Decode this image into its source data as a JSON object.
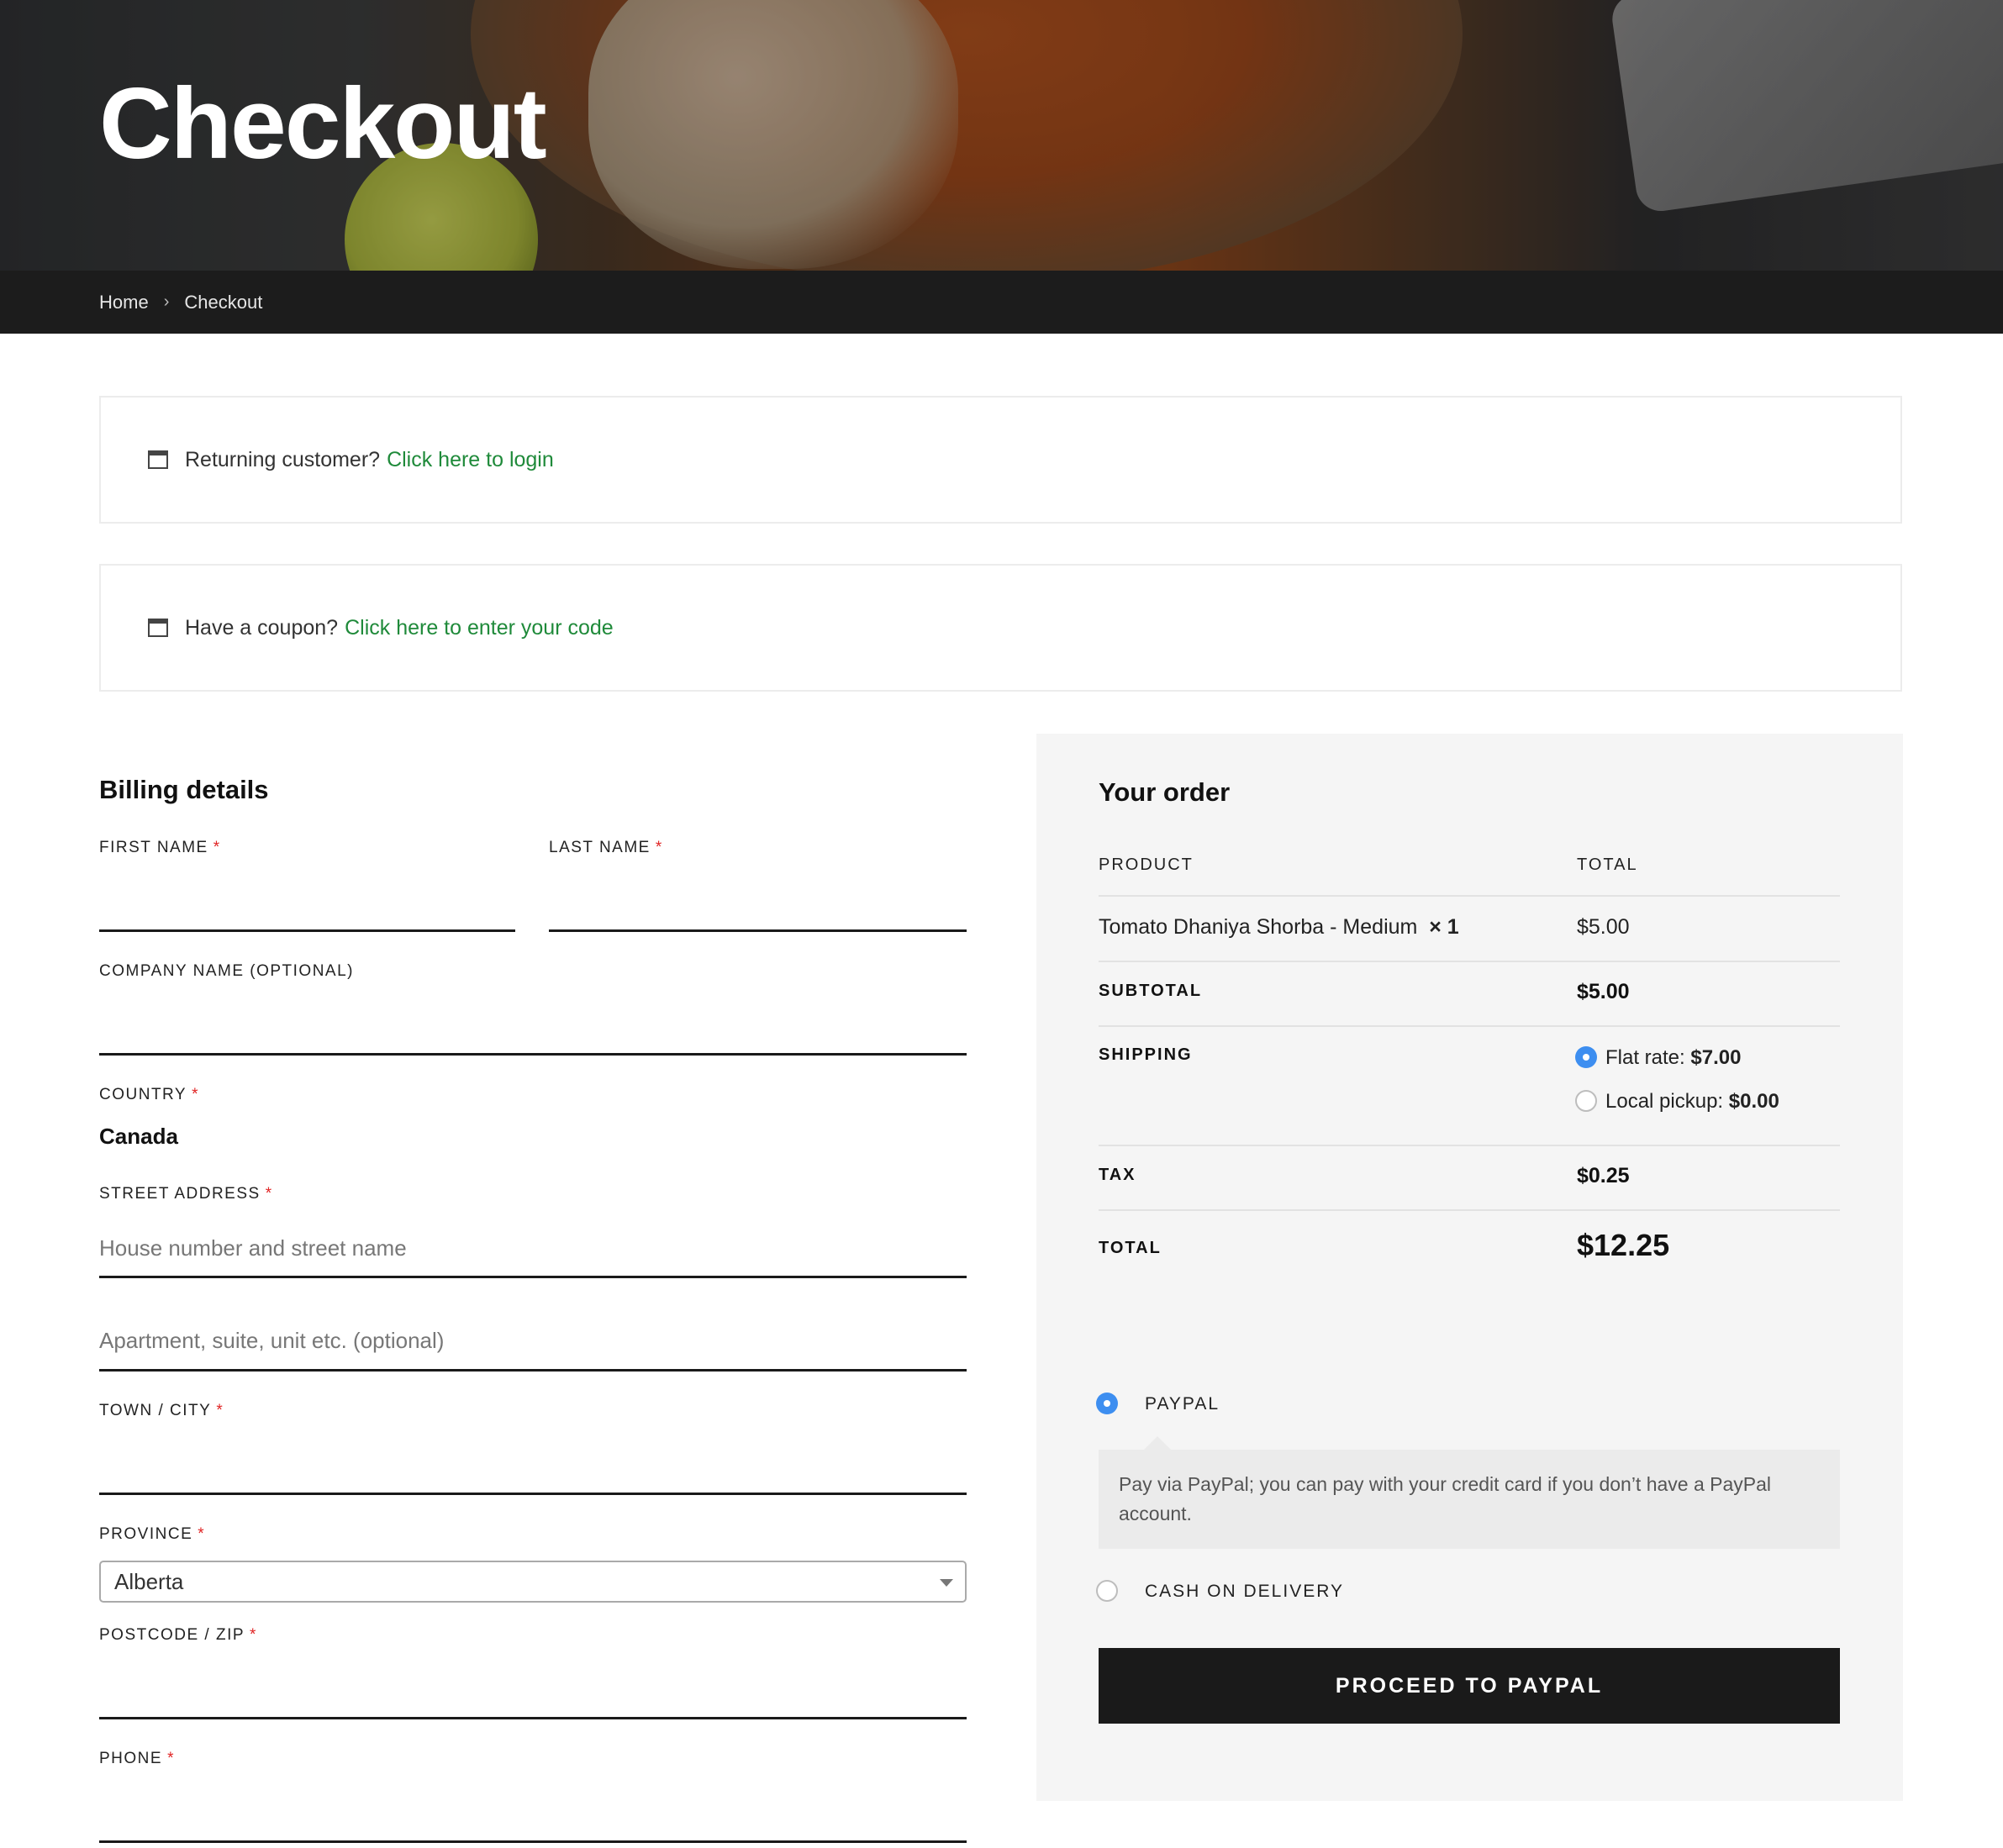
{
  "hero": {
    "title": "Checkout"
  },
  "breadcrumb": {
    "items": [
      "Home",
      "Checkout"
    ],
    "separator": "›"
  },
  "notices": [
    {
      "text": "Returning customer?",
      "link": "Click here to login"
    },
    {
      "text": "Have a coupon?",
      "link": "Click here to enter your code"
    }
  ],
  "billing": {
    "title": "Billing details",
    "first_name": {
      "label": "FIRST NAME",
      "value": ""
    },
    "last_name": {
      "label": "LAST NAME",
      "value": ""
    },
    "company": {
      "label": "COMPANY NAME (OPTIONAL)",
      "value": ""
    },
    "country": {
      "label": "COUNTRY",
      "value": "Canada"
    },
    "street": {
      "label": "STREET ADDRESS",
      "placeholder1": "House number and street name",
      "placeholder2": "Apartment, suite, unit etc. (optional)"
    },
    "city": {
      "label": "TOWN / CITY",
      "value": ""
    },
    "province": {
      "label": "PROVINCE",
      "selected": "Alberta"
    },
    "postcode": {
      "label": "POSTCODE / ZIP",
      "value": ""
    },
    "phone": {
      "label": "PHONE",
      "value": ""
    },
    "required_mark": "*"
  },
  "order": {
    "title": "Your order",
    "headers": {
      "product": "PRODUCT",
      "total": "TOTAL"
    },
    "items": [
      {
        "name": "Tomato Dhaniya Shorba - Medium",
        "qty": "× 1",
        "total": "$5.00"
      }
    ],
    "subtotal": {
      "label": "SUBTOTAL",
      "value": "$5.00"
    },
    "shipping": {
      "label": "SHIPPING",
      "options": [
        {
          "label": "Flat rate:",
          "price": "$7.00",
          "selected": true
        },
        {
          "label": "Local pickup:",
          "price": "$0.00",
          "selected": false
        }
      ]
    },
    "tax": {
      "label": "TAX",
      "value": "$0.25"
    },
    "total": {
      "label": "TOTAL",
      "value": "$12.25"
    }
  },
  "payment": {
    "methods": [
      {
        "label": "PAYPAL",
        "selected": true,
        "description": "Pay via PayPal; you can pay with your credit card if you don’t have a PayPal account."
      },
      {
        "label": "CASH ON DELIVERY",
        "selected": false
      }
    ],
    "button": "PROCEED TO PAYPAL"
  },
  "colors": {
    "accent_link": "#1f8a3a",
    "radio_selected": "#3d8ef0",
    "button_bg": "#1a1a1a",
    "required": "#e02424"
  }
}
